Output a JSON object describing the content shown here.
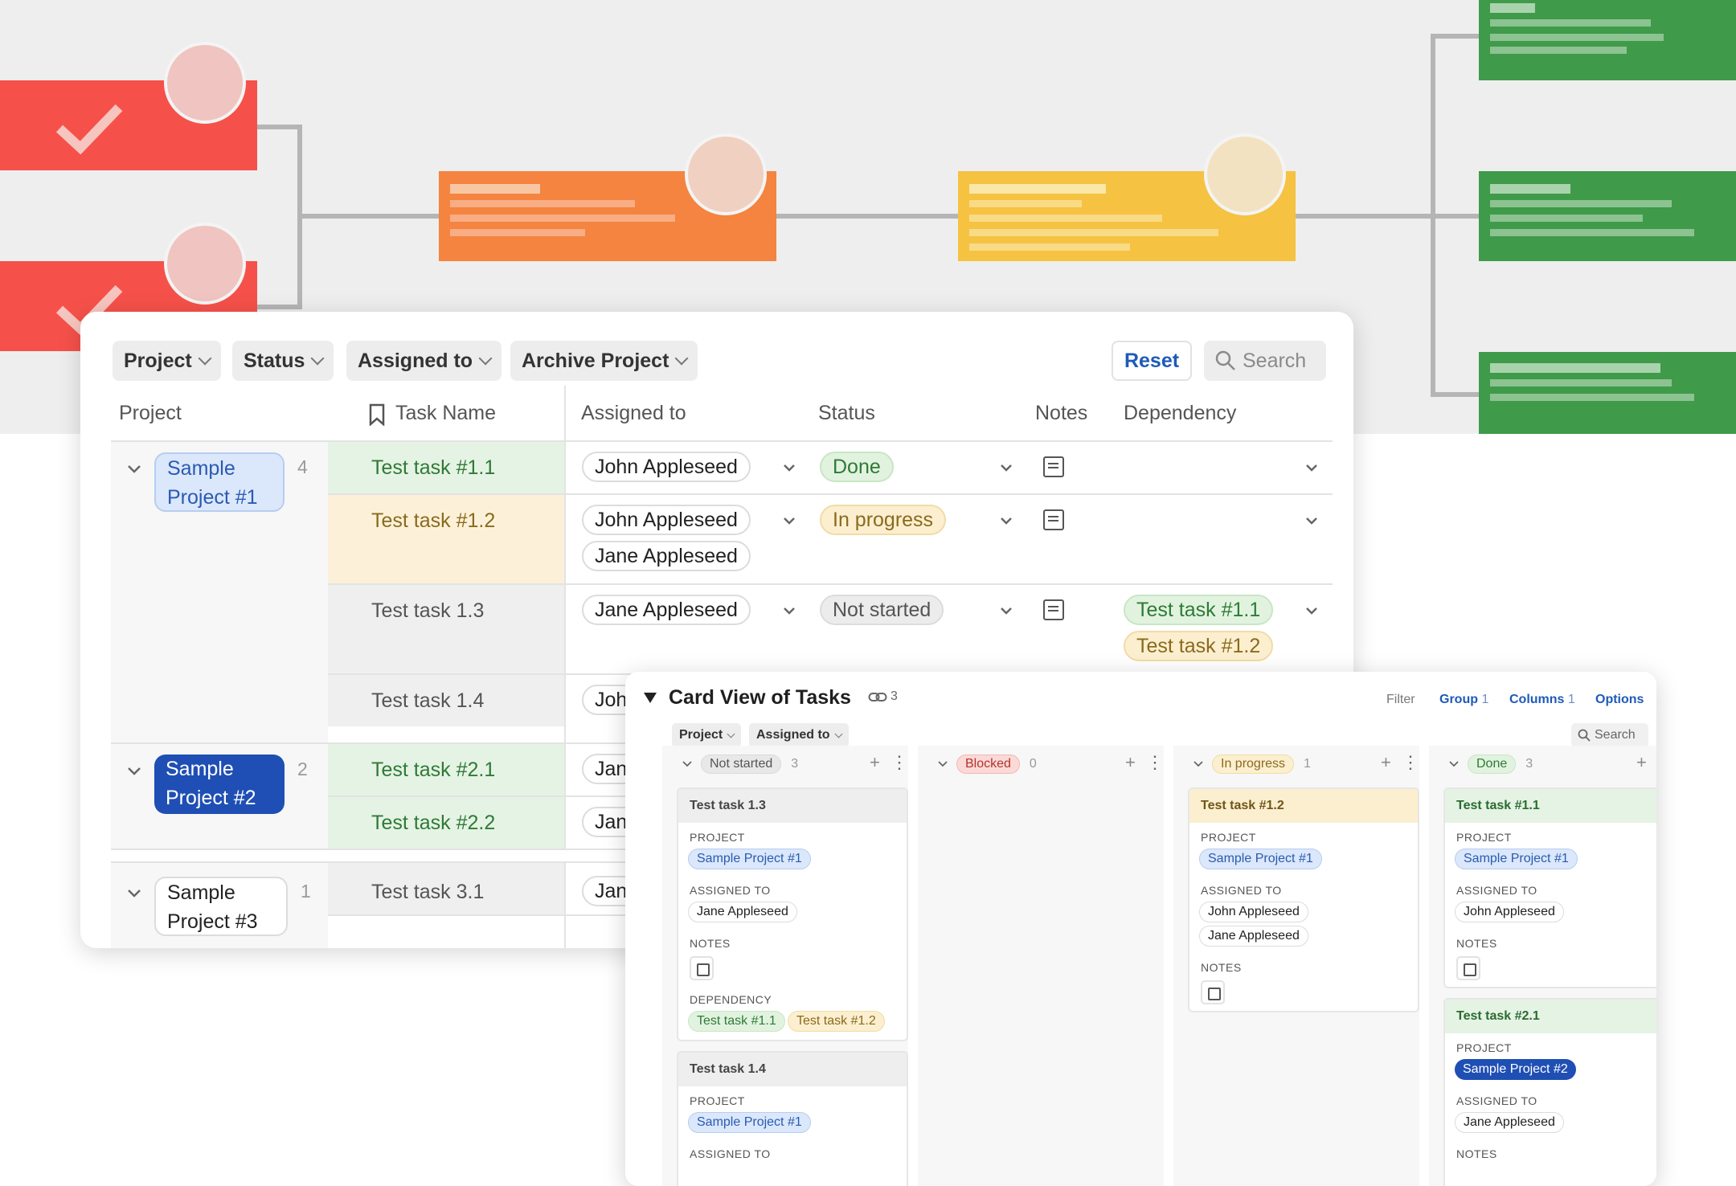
{
  "colors": {
    "red": "#f5514a",
    "orange": "#f4843f",
    "yellow": "#f5c242",
    "green": "#3f9a4a",
    "link_blue": "#1e5ab8"
  },
  "table": {
    "filters": [
      "Project",
      "Status",
      "Assigned to",
      "Archive Project"
    ],
    "reset_label": "Reset",
    "search_label": "Search",
    "columns": [
      "Project",
      "Task Name",
      "Assigned to",
      "Status",
      "Notes",
      "Dependency"
    ],
    "groups": [
      {
        "project": "Sample Project #1",
        "count": "4"
      },
      {
        "project": "Sample Project #2",
        "count": "2"
      },
      {
        "project": "Sample Project #3",
        "count": "1"
      }
    ],
    "rows": [
      {
        "task": "Test task #1.1",
        "assigned": [
          "John Appleseed"
        ],
        "status": "Done",
        "deps": []
      },
      {
        "task": "Test task #1.2",
        "assigned": [
          "John Appleseed",
          "Jane Appleseed"
        ],
        "status": "In progress",
        "deps": []
      },
      {
        "task": "Test task 1.3",
        "assigned": [
          "Jane Appleseed"
        ],
        "status": "Not started",
        "deps": [
          "Test task #1.1",
          "Test task #1.2"
        ]
      },
      {
        "task": "Test task 1.4",
        "assigned": [
          "Joh"
        ]
      },
      {
        "task": "Test task #2.1",
        "assigned": [
          "Jan"
        ]
      },
      {
        "task": "Test task #2.2",
        "assigned": [
          "Jan"
        ]
      },
      {
        "task": "Test task 3.1",
        "assigned": [
          "Jan"
        ]
      }
    ]
  },
  "cardview": {
    "title": "Card View of Tasks",
    "link_count": "3",
    "toolbar": {
      "filter": "Filter",
      "group": "Group",
      "group_count": "1",
      "columns": "Columns",
      "columns_count": "1",
      "options": "Options"
    },
    "chips": [
      "Project",
      "Assigned to"
    ],
    "search_label": "Search",
    "field_labels": {
      "project": "PROJECT",
      "assigned": "ASSIGNED TO",
      "notes": "NOTES",
      "dependency": "DEPENDENCY"
    },
    "columns_list": [
      {
        "name": "Not started",
        "count": "3"
      },
      {
        "name": "Blocked",
        "count": "0"
      },
      {
        "name": "In progress",
        "count": "1"
      },
      {
        "name": "Done",
        "count": "3"
      }
    ],
    "cards": {
      "c13": {
        "title": "Test task 1.3",
        "project": "Sample Project #1",
        "assigned": [
          "Jane Appleseed"
        ],
        "deps": [
          "Test task #1.1",
          "Test task #1.2"
        ]
      },
      "c14": {
        "title": "Test task 1.4",
        "project": "Sample Project #1"
      },
      "c12": {
        "title": "Test task #1.2",
        "project": "Sample Project #1",
        "assigned": [
          "John Appleseed",
          "Jane Appleseed"
        ]
      },
      "c11": {
        "title": "Test task #1.1",
        "project": "Sample Project #1",
        "assigned": [
          "John Appleseed"
        ]
      },
      "c21": {
        "title": "Test task #2.1",
        "project": "Sample Project #2",
        "assigned": [
          "Jane Appleseed"
        ]
      }
    }
  }
}
